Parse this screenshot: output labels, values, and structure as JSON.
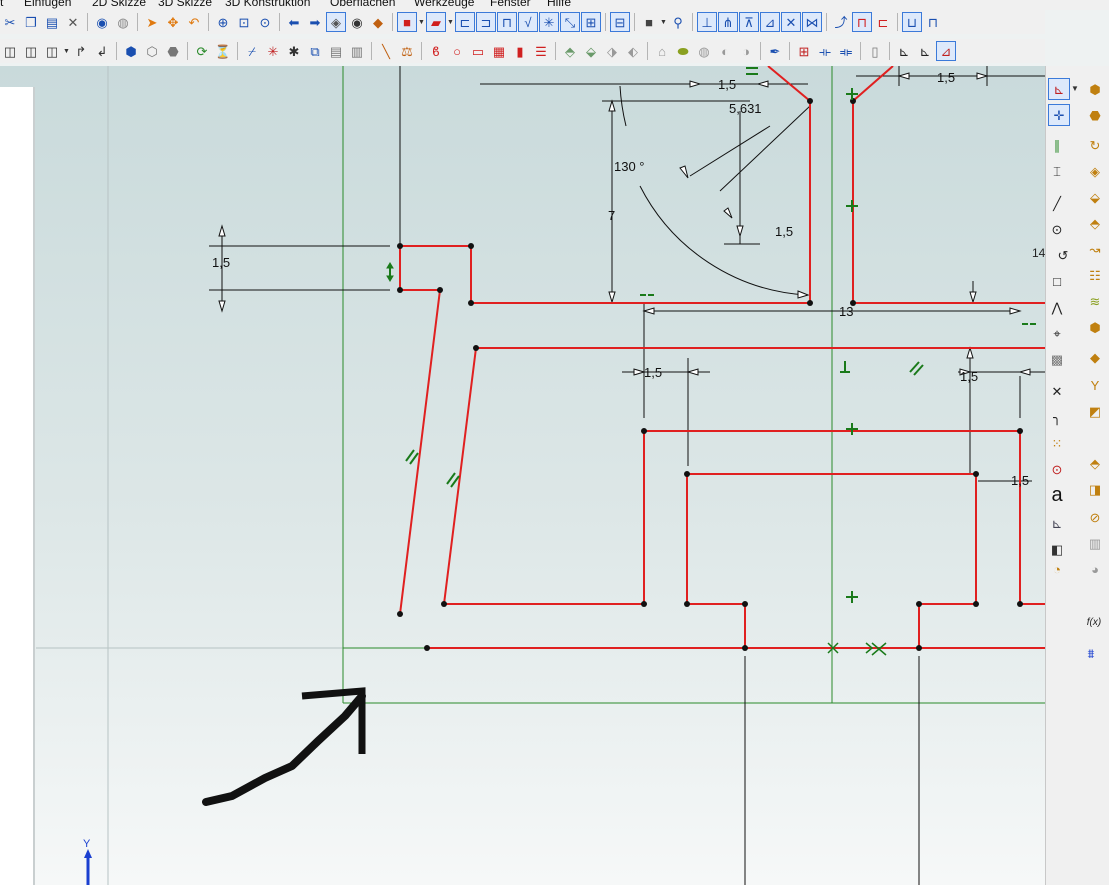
{
  "menu": {
    "items": [
      "Einfügen",
      "2D Skizze",
      "3D Skizze",
      "3D Konstruktion",
      "Oberflächen",
      "Werkzeuge",
      "Fenster",
      "Hilfe"
    ]
  },
  "toolbar1_icons": [
    "cut-icon",
    "copy-icon",
    "paste-icon",
    "delete-icon",
    "record-icon",
    "stop-icon",
    "select-arrow-icon",
    "move-icon",
    "undo-arc-icon",
    "zoom-in-icon",
    "zoom-window-icon",
    "zoom-all-icon",
    "back-icon",
    "forward-icon",
    "view-cube-icon",
    "eye-icon",
    "render-icon",
    "solid-red-icon",
    "solid-red-2-icon",
    "dim-1-icon",
    "dim-2-icon",
    "dim-3-icon",
    "dim-4-icon",
    "dim-5-icon",
    "dim-6-icon",
    "dim-7-icon",
    "view-icon",
    "box-icon",
    "tree-icon",
    "constraint-1-icon",
    "constraint-2-icon",
    "constraint-3-icon",
    "constraint-4-icon",
    "constraint-5-icon",
    "constraint-6-icon",
    "curve-1-icon",
    "curve-2-icon",
    "curve-3-icon",
    "frame-1-icon",
    "frame-2-icon"
  ],
  "toolbar2_icons": [
    "frame-a-icon",
    "frame-b-icon",
    "frame-c-icon",
    "fold-1-icon",
    "fold-2-icon",
    "part-1-icon",
    "part-2-icon",
    "part-3-icon",
    "part-4-icon",
    "pin-icon",
    "axis-icon",
    "point-icon",
    "component-icon",
    "list-icon",
    "ruler-icon",
    "balance-icon",
    "sketch-1-icon",
    "circle-icon",
    "rect-icon",
    "pattern-icon",
    "cylinder-icon",
    "lines-icon",
    "tool-1-icon",
    "tool-2-icon",
    "tool-3-icon",
    "tool-4-icon",
    "tool-5-icon",
    "tool-6-icon",
    "tool-7-icon",
    "tool-8-icon",
    "tool-9-icon",
    "pen-icon",
    "grid-icon",
    "align-1-icon",
    "align-2-icon",
    "align-3-icon",
    "corner-1-icon",
    "corner-2-icon",
    "sketch-edit-icon"
  ],
  "rightbar": {
    "icons": [
      "sketch-mode-icon",
      "point-snap-icon",
      "parallel-icon",
      "dimension-icon",
      "line-icon",
      "circle-icon",
      "arc-icon",
      "rectangle-icon",
      "polyline-icon",
      "center-point-icon",
      "fill-icon",
      "trim-icon",
      "fillet-icon",
      "pattern-icon",
      "circle-center-icon",
      "text-icon",
      "sketch-box-icon",
      "solid-1-icon",
      "solid-2-icon"
    ],
    "arc_label": "14",
    "text_tool_label": "a",
    "function_label": "f(x)"
  },
  "canvas": {
    "dim_1_5_a": "1,5",
    "dim_1_5_b": "1,5",
    "dim_1_5_c": "1,5",
    "dim_1_5_d": "1,5",
    "dim_1_5_e": "1,5",
    "dim_1_5_f": "1,5",
    "dim_1_5_g": "1,5",
    "dim_5631": "5,631",
    "dim_130": "130 °",
    "dim_7": "7",
    "dim_13": "13",
    "axis_y": "Y"
  },
  "colors": {
    "canvas_top": "#c9dadb",
    "canvas_bottom": "#f6f8f8",
    "sketch_red": "#e02020",
    "dim_black": "#111111",
    "constraint_green": "#1a7a1a",
    "accent_blue": "#1a4fb0"
  }
}
